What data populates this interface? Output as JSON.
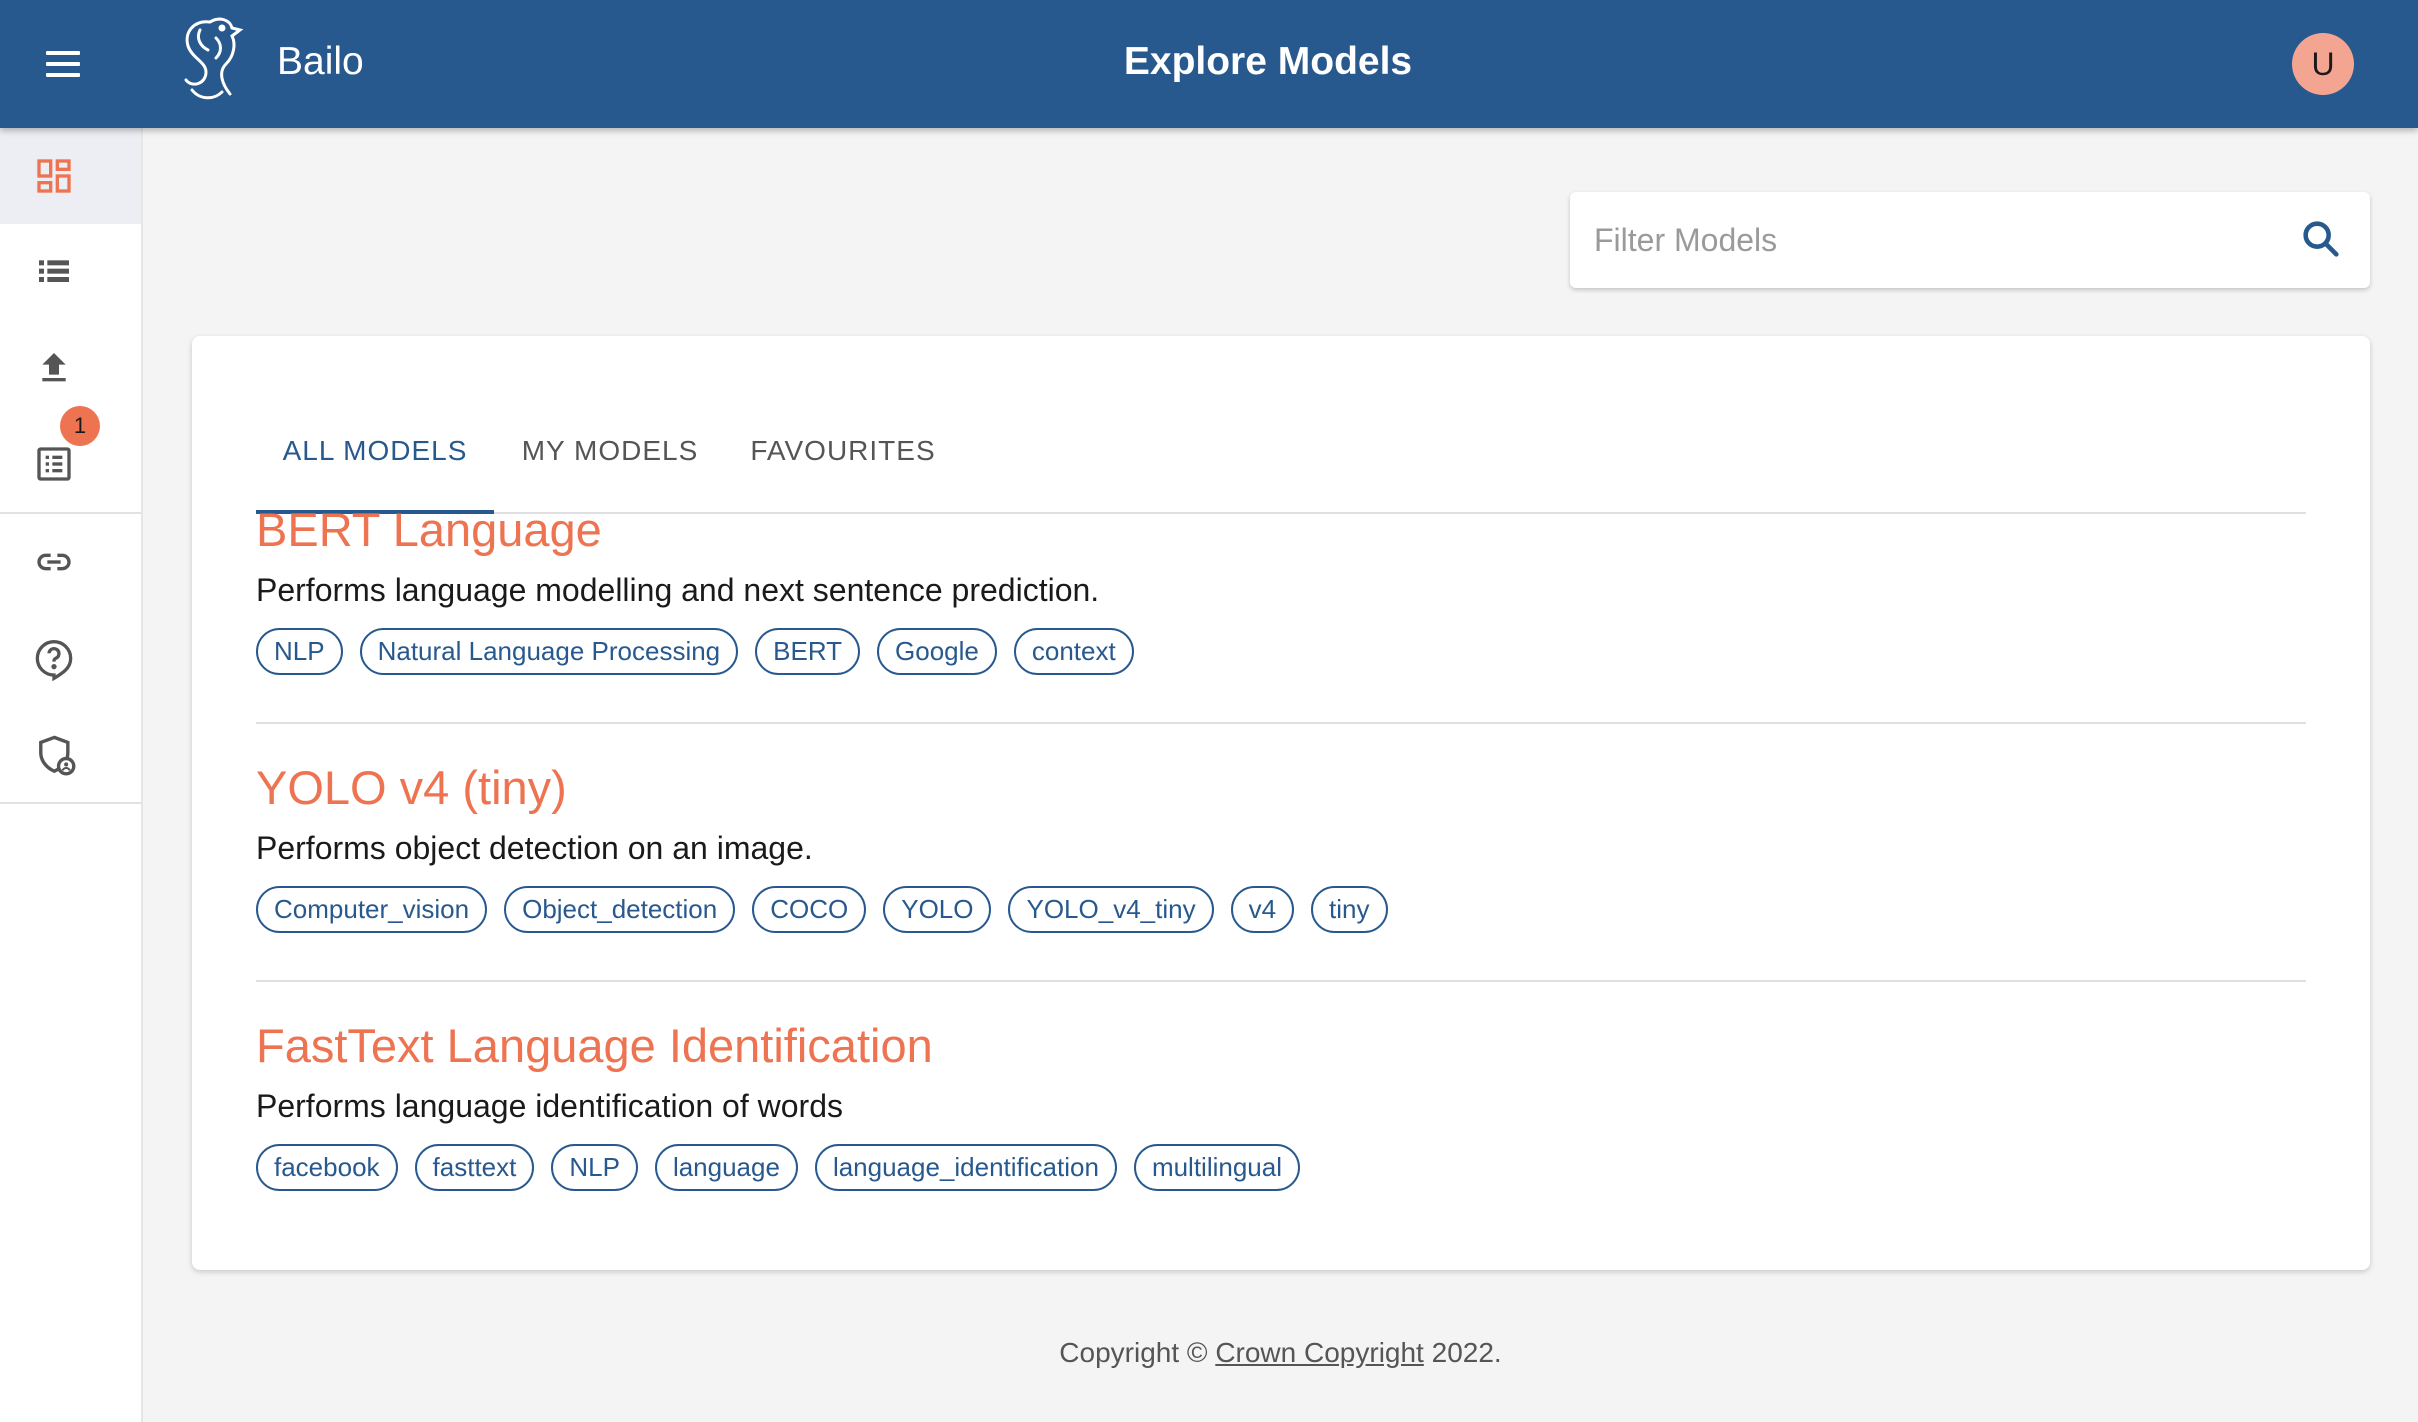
{
  "header": {
    "brand": "Bailo",
    "title": "Explore Models",
    "avatar_initial": "U",
    "icons": {
      "menu": "menu-icon",
      "logo": "bailo-seahorse-logo"
    }
  },
  "sidebar": {
    "items": [
      {
        "icon": "dashboard-icon",
        "active": true
      },
      {
        "icon": "list-icon",
        "active": false
      },
      {
        "icon": "upload-icon",
        "active": false
      },
      {
        "icon": "review-list-icon",
        "active": false,
        "badge": "1"
      },
      {
        "icon": "link-icon",
        "active": false
      },
      {
        "icon": "help-icon",
        "active": false
      },
      {
        "icon": "admin-shield-icon",
        "active": false
      }
    ]
  },
  "search": {
    "placeholder": "Filter Models",
    "value": "",
    "icon": "search-icon"
  },
  "tabs": [
    {
      "label": "ALL MODELS",
      "active": true
    },
    {
      "label": "MY MODELS",
      "active": false
    },
    {
      "label": "FAVOURITES",
      "active": false
    }
  ],
  "models": [
    {
      "name": "BERT Language",
      "description": "Performs language modelling and next sentence prediction.",
      "tags": [
        "NLP",
        "Natural Language Processing",
        "BERT",
        "Google",
        "context"
      ]
    },
    {
      "name": "YOLO v4 (tiny)",
      "description": "Performs object detection on an image.",
      "tags": [
        "Computer_vision",
        "Object_detection",
        "COCO",
        "YOLO",
        "YOLO_v4_tiny",
        "v4",
        "tiny"
      ]
    },
    {
      "name": "FastText Language Identification",
      "description": "Performs language identification of words",
      "tags": [
        "facebook",
        "fasttext",
        "NLP",
        "language",
        "language_identification",
        "multilingual"
      ]
    }
  ],
  "footer": {
    "prefix": "Copyright © ",
    "link": "Crown Copyright",
    "suffix": " 2022."
  },
  "colors": {
    "primary": "#28598e",
    "accent": "#ee7350",
    "background": "#f4f4f4",
    "avatar": "#f4a592"
  }
}
